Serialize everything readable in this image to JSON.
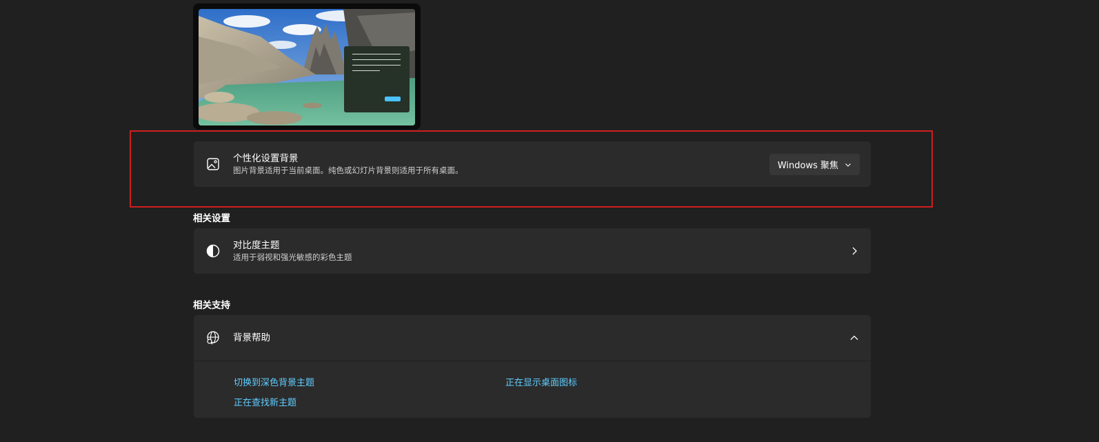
{
  "preview": {
    "image_name": "mountain-lake-landscape"
  },
  "background_setting": {
    "title": "个性化设置背景",
    "subtitle": "图片背景适用于当前桌面。纯色或幻灯片背景则适用于所有桌面。",
    "icon": "picture-icon",
    "dropdown_value": "Windows 聚焦"
  },
  "related_settings": {
    "heading": "相关设置",
    "items": [
      {
        "title": "对比度主题",
        "subtitle": "适用于弱视和强光敏感的彩色主题",
        "icon": "contrast-icon"
      }
    ]
  },
  "related_support": {
    "heading": "相关支持",
    "help": {
      "title": "背景帮助",
      "icon": "globe-search-icon",
      "expanded": true
    },
    "links": [
      "切换到深色背景主题",
      "正在显示桌面图标",
      "正在查找新主题"
    ]
  },
  "colors": {
    "page_bg": "#202020",
    "card_bg": "#2b2b2b",
    "link": "#60cdff",
    "accent": "#4cc2ff",
    "highlight": "#d01e1e"
  }
}
